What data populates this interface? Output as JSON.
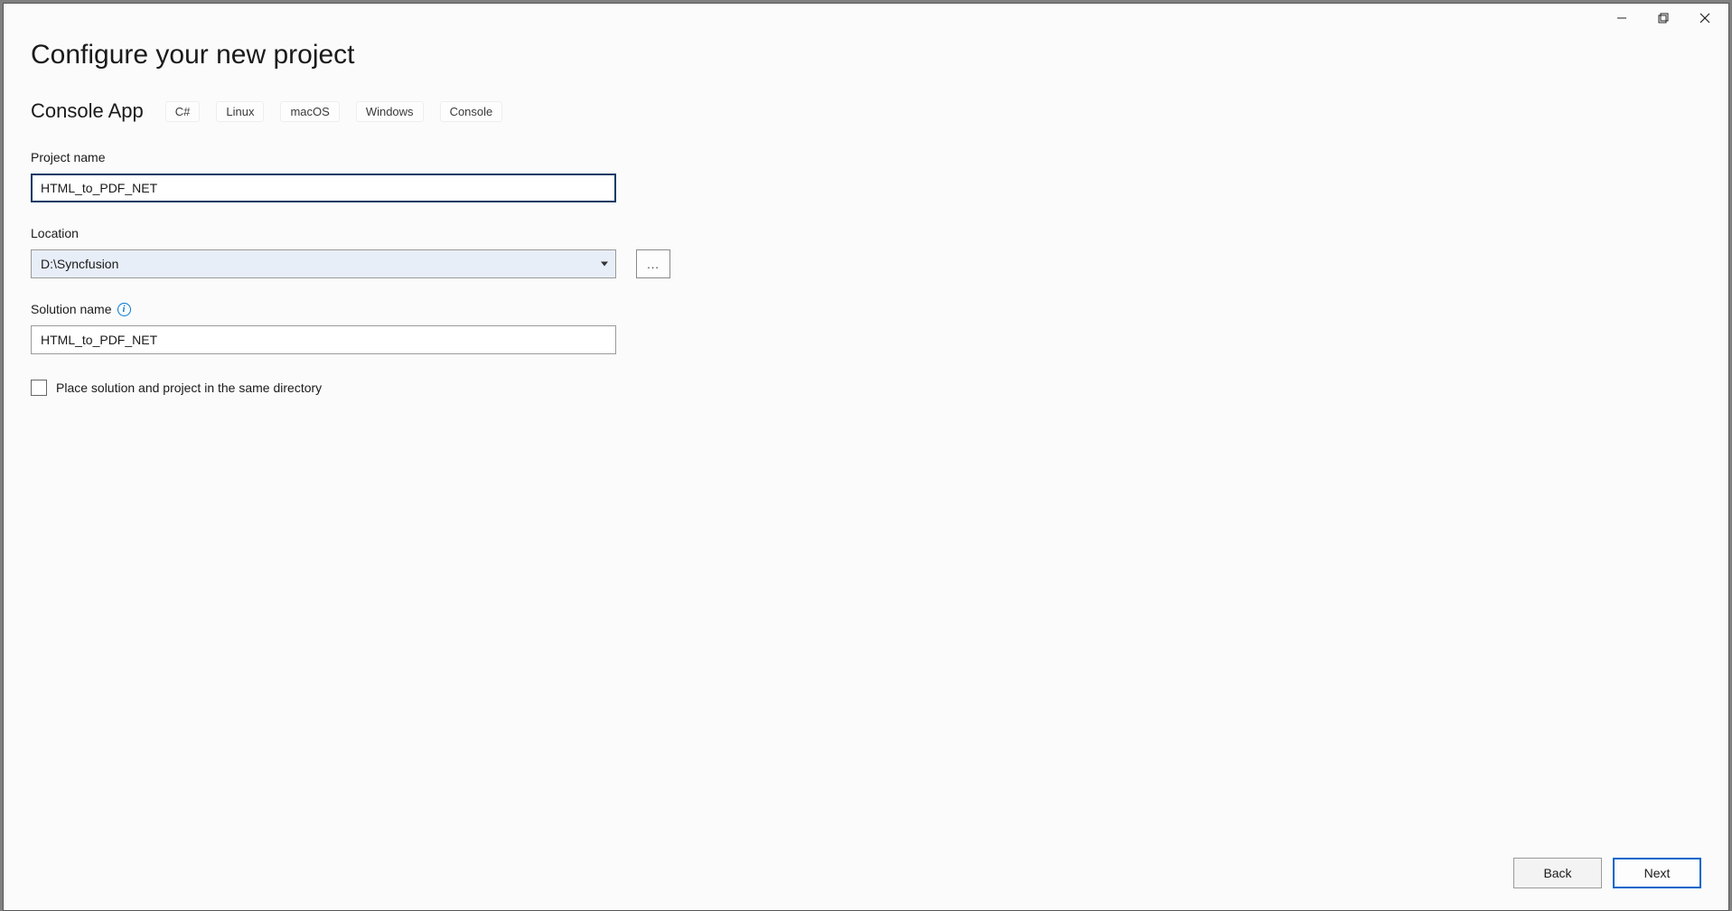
{
  "page": {
    "title": "Configure your new project"
  },
  "template": {
    "name": "Console App",
    "tags": [
      "C#",
      "Linux",
      "macOS",
      "Windows",
      "Console"
    ]
  },
  "fields": {
    "project_name": {
      "label": "Project name",
      "value": "HTML_to_PDF_NET"
    },
    "location": {
      "label": "Location",
      "value": "D:\\Syncfusion",
      "browse_label": "..."
    },
    "solution_name": {
      "label": "Solution name",
      "value": "HTML_to_PDF_NET"
    },
    "same_directory": {
      "label": "Place solution and project in the same directory",
      "checked": false
    }
  },
  "footer": {
    "back": "Back",
    "next": "Next"
  }
}
